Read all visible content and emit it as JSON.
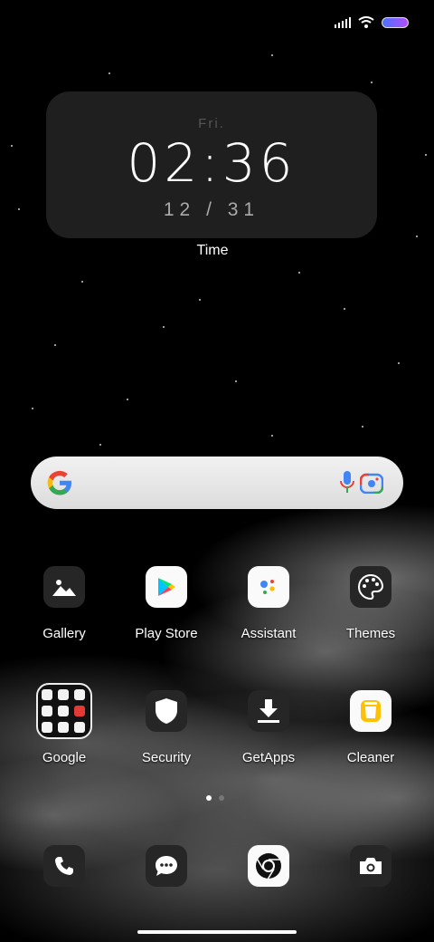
{
  "clock": {
    "day": "Fri.",
    "time": "02:36",
    "date": "12 / 31",
    "label": "Time"
  },
  "search": {
    "logo": "google-g-icon",
    "mic": "mic-icon",
    "lens": "lens-icon"
  },
  "apps_row1": [
    {
      "label": "Gallery",
      "icon": "gallery-icon"
    },
    {
      "label": "Play Store",
      "icon": "play-store-icon"
    },
    {
      "label": "Assistant",
      "icon": "assistant-icon"
    },
    {
      "label": "Themes",
      "icon": "palette-icon"
    }
  ],
  "apps_row2": [
    {
      "label": "Google",
      "icon": "folder-icon"
    },
    {
      "label": "Security",
      "icon": "shield-icon"
    },
    {
      "label": "GetApps",
      "icon": "download-icon"
    },
    {
      "label": "Cleaner",
      "icon": "trash-icon"
    }
  ],
  "dock": [
    {
      "icon": "phone-icon"
    },
    {
      "icon": "messages-icon"
    },
    {
      "icon": "chrome-icon"
    },
    {
      "icon": "camera-icon"
    }
  ],
  "page_indicator": {
    "pages": 2,
    "current": 1
  }
}
